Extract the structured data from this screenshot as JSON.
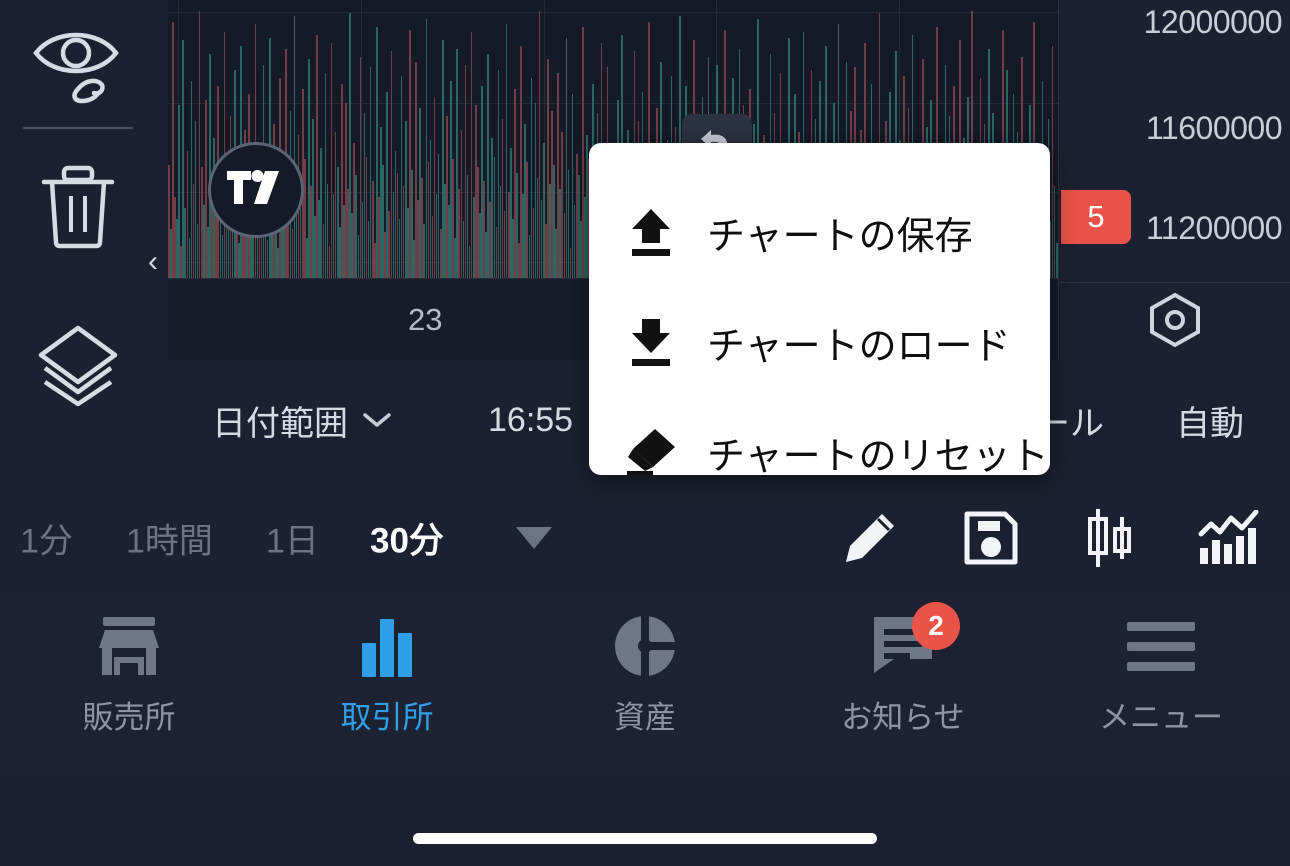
{
  "chart": {
    "price_axis": {
      "labels": [
        "12000000",
        "11600000",
        "11200000"
      ],
      "badge_value": "5",
      "badge_color": "#e8524a"
    },
    "time_axis": {
      "tick": "23"
    },
    "logo_name": "tradingview-logo",
    "collapse_chevron": "‹",
    "settings_icon": "hex-settings-icon"
  },
  "chart_data": {
    "type": "bar",
    "title": "",
    "xlabel": "",
    "ylabel": "",
    "categories": [
      "23"
    ],
    "series": [
      {
        "name": "volume-up",
        "color": "#2f6f6b"
      },
      {
        "name": "volume-down",
        "color": "#7c4248"
      }
    ],
    "ylim": [
      11000000,
      12200000
    ],
    "yticks": [
      12000000,
      11600000,
      11200000
    ],
    "grid": true,
    "legend": "none",
    "values": [
      42,
      18,
      95,
      30,
      22,
      64,
      12,
      88,
      26,
      47,
      15,
      73,
      35,
      58,
      20,
      99,
      41,
      27,
      66,
      19,
      83,
      31,
      52,
      24,
      71,
      38,
      16,
      91,
      29,
      45,
      60,
      23,
      77,
      34,
      13,
      86,
      28,
      55,
      21,
      68,
      39,
      17,
      94,
      33,
      49,
      25,
      79,
      36,
      14,
      89,
      32,
      57,
      43,
      11,
      74,
      40,
      22,
      85,
      30,
      62,
      18,
      97,
      37,
      53,
      26,
      70,
      44,
      15,
      81,
      34,
      59,
      23,
      90,
      29,
      48,
      20,
      76,
      35,
      12,
      87,
      31,
      54,
      41,
      19,
      72,
      27,
      65,
      33,
      98,
      24,
      50,
      38,
      16,
      82,
      28,
      61,
      45,
      21,
      78,
      36,
      13,
      93,
      30,
      56,
      42,
      17,
      69,
      25,
      84,
      32,
      47,
      39,
      22,
      75,
      34,
      58,
      26,
      92,
      40,
      14,
      80,
      29,
      63,
      37,
      20,
      96,
      43,
      51,
      23,
      67,
      31,
      46,
      18,
      88,
      35,
      60,
      27,
      73,
      44,
      15,
      85,
      33,
      55,
      21,
      79,
      38,
      12,
      91,
      30,
      64,
      41,
      24,
      71,
      36,
      17,
      83,
      28,
      52,
      45,
      19,
      77,
      34,
      59,
      25,
      94,
      32,
      48,
      22,
      70,
      39,
      13,
      86,
      31,
      57,
      43,
      16,
      74,
      26,
      65,
      37,
      99,
      29,
      50,
      20,
      81,
      35,
      62,
      42,
      18,
      76,
      33,
      54,
      24,
      89,
      40,
      11,
      68,
      27,
      46,
      38,
      21,
      93,
      30,
      53,
      44,
      17,
      72,
      34,
      61,
      23,
      87,
      36,
      14,
      78,
      32,
      49,
      41,
      19,
      66,
      28,
      90,
      39,
      25,
      55,
      45,
      15,
      84,
      31,
      58,
      22,
      69,
      37,
      12,
      95,
      26,
      47,
      33,
      63,
      20,
      80,
      43,
      29,
      51,
      16,
      75,
      35,
      56,
      24,
      97,
      40,
      18,
      71,
      34,
      44,
      27,
      88,
      30,
      60,
      21,
      67,
      42,
      13,
      82,
      38,
      52,
      23,
      79,
      36,
      45,
      17,
      92,
      31,
      48,
      25,
      74,
      39,
      14,
      85,
      28,
      64,
      43,
      22,
      70,
      32,
      57,
      19,
      96,
      41,
      26,
      53,
      37,
      12,
      83,
      30,
      61,
      46,
      20,
      76,
      35,
      44,
      24,
      89,
      33,
      15,
      68,
      40,
      54,
      27,
      91,
      29,
      49,
      21,
      77,
      38,
      59,
      16,
      73,
      42,
      31,
      86,
      23,
      50,
      18,
      65,
      36,
      94,
      34,
      45,
      25,
      80,
      28,
      62,
      13,
      78,
      43,
      32,
      55,
      20,
      87,
      39,
      17,
      72,
      30,
      47,
      26,
      98,
      41,
      35,
      58,
      22,
      69,
      44,
      14,
      84,
      33,
      51,
      19,
      75,
      37,
      63,
      24,
      90,
      29,
      46,
      40,
      11,
      81,
      34,
      56,
      27,
      66,
      42,
      21,
      93,
      31,
      48,
      18,
      79,
      38,
      60,
      25,
      71,
      45,
      15,
      88,
      32,
      52,
      23,
      67,
      36,
      99,
      28,
      43,
      20,
      74,
      39,
      57,
      30,
      85,
      16,
      61,
      44,
      26,
      50,
      33,
      92,
      22,
      77,
      41,
      12,
      68,
      35,
      54,
      29,
      82,
      19,
      47,
      37,
      64,
      24,
      95,
      31,
      42,
      17,
      73,
      45,
      27,
      59,
      21,
      86,
      34,
      13
    ]
  },
  "left_rail": {
    "items": [
      {
        "name": "hide-drawings-icon",
        "label": "hide-drawings"
      },
      {
        "name": "trash-icon",
        "label": "delete-drawings"
      },
      {
        "name": "layers-icon",
        "label": "object-tree"
      }
    ]
  },
  "chart_meta": {
    "date_range_label": "日付範囲",
    "date_range_chevron": "⌄",
    "time_label": "16:55",
    "scale_label": "ール",
    "auto_label": "自動"
  },
  "timeframes": {
    "items": [
      {
        "label": "1分",
        "active": false
      },
      {
        "label": "1時間",
        "active": false
      },
      {
        "label": "1日",
        "active": false
      },
      {
        "label": "30分",
        "active": true
      }
    ],
    "more_caret": "more-timeframes"
  },
  "chart_tools": [
    {
      "name": "pencil-icon",
      "label": "draw"
    },
    {
      "name": "floppy-save-icon",
      "label": "save"
    },
    {
      "name": "candlestick-icon",
      "label": "chart-type"
    },
    {
      "name": "indicator-chart-icon",
      "label": "indicators"
    }
  ],
  "undo_button": {
    "name": "undo-icon",
    "label": "undo"
  },
  "popup": {
    "items": [
      {
        "icon": "upload-arrow-icon",
        "label": "チャートの保存"
      },
      {
        "icon": "download-arrow-icon",
        "label": "チャートのロード"
      },
      {
        "icon": "eraser-icon",
        "label": "チャートのリセット"
      }
    ]
  },
  "bottom_nav": {
    "items": [
      {
        "label": "販売所",
        "icon": "store-icon",
        "active": false,
        "badge": null
      },
      {
        "label": "取引所",
        "icon": "bar-chart-icon",
        "active": true,
        "badge": null
      },
      {
        "label": "資産",
        "icon": "pie-chart-icon",
        "active": false,
        "badge": null
      },
      {
        "label": "お知らせ",
        "icon": "notification-icon",
        "active": false,
        "badge": "2"
      },
      {
        "label": "メニュー",
        "icon": "hamburger-icon",
        "active": false,
        "badge": null
      }
    ]
  }
}
